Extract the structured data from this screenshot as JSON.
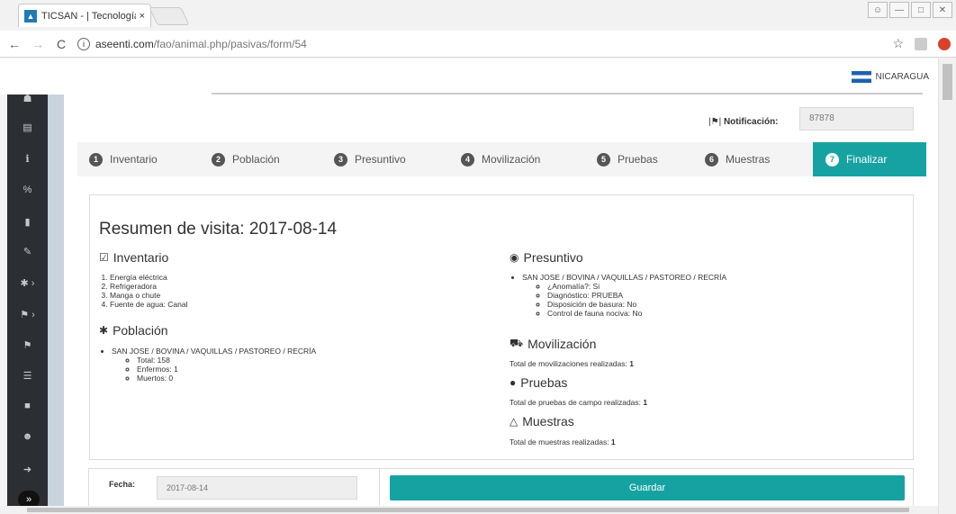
{
  "browser": {
    "tab_title": "TICSAN - | Tecnología de",
    "tab_close": "×",
    "url_host": "aseenti.com",
    "url_path": "/fao/animal.php/pasivas/form/54",
    "back": "←",
    "forward": "→",
    "reload": "C",
    "info": "i",
    "star": "☆"
  },
  "header": {
    "country": "NICARAGUA",
    "notif_label_prefix": "|⚑| ",
    "notif_label": "Notificación:",
    "notif_value": "87878"
  },
  "steps": [
    {
      "num": "1",
      "label": "Inventario"
    },
    {
      "num": "2",
      "label": "Población"
    },
    {
      "num": "3",
      "label": "Presuntivo"
    },
    {
      "num": "4",
      "label": "Movilización"
    },
    {
      "num": "5",
      "label": "Pruebas"
    },
    {
      "num": "6",
      "label": "Muestras"
    },
    {
      "num": "7",
      "label": "Finalizar"
    }
  ],
  "summary": {
    "title": "Resumen de visita: 2017-08-14",
    "inventario": {
      "heading": "Inventario",
      "items": [
        "Energía eléctrica",
        "Refrigeradora",
        "Manga o chute",
        "Fuente de agua: Canal"
      ]
    },
    "poblacion": {
      "heading": "Población",
      "group": "SAN JOSE / BOVINA / VAQUILLAS / PASTOREO / RECRÍA",
      "items": [
        "Total: 158",
        "Enfermos: 1",
        "Muertos: 0"
      ]
    },
    "presuntivo": {
      "heading": "Presuntivo",
      "group": "SAN JOSE / BOVINA / VAQUILLAS / PASTOREO / RECRÍA",
      "items": [
        "¿Anomalía?: Si",
        "Diagnóstico: PRUEBA",
        "Disposición de basura: No",
        "Control de fauna nociva: No"
      ]
    },
    "movilizacion": {
      "heading": "Movilización",
      "text": "Total de movilizaciones realizadas: ",
      "value": "1"
    },
    "pruebas": {
      "heading": "Pruebas",
      "text": "Total de pruebas de campo realizadas: ",
      "value": "1"
    },
    "muestras": {
      "heading": "Muestras",
      "text": "Total de muestras realizadas: ",
      "value": "1"
    }
  },
  "footer": {
    "fecha_label": "Fecha:",
    "fecha_value": "2017-08-14",
    "save_label": "Guardar"
  },
  "colors": {
    "accent": "#17a2a2",
    "sidebar": "#2b2e33"
  }
}
